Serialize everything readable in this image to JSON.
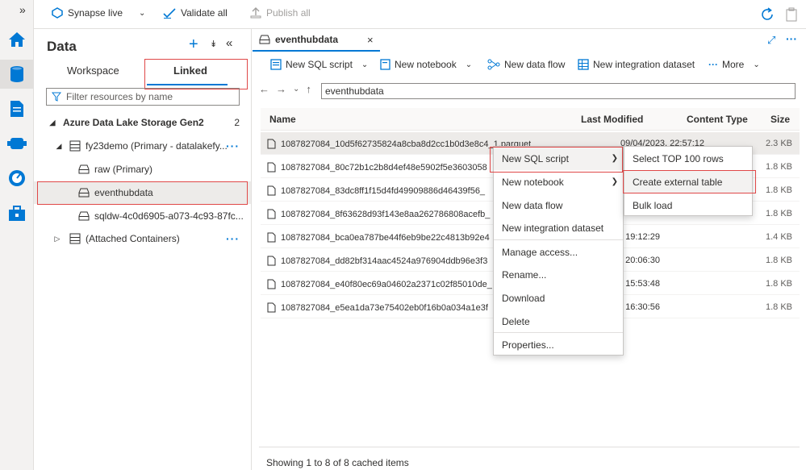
{
  "topbar": {
    "synapse_live": "Synapse live",
    "validate_all": "Validate all",
    "publish_all": "Publish all"
  },
  "data_pane": {
    "title": "Data",
    "tabs": [
      "Workspace",
      "Linked"
    ],
    "active_tab": "Linked",
    "filter_placeholder": "Filter resources by name",
    "section": "Azure Data Lake Storage Gen2",
    "section_count": "2",
    "tree": {
      "account": "fy23demo (Primary - datalakefy...",
      "containers": [
        "raw (Primary)",
        "eventhubdata",
        "sqldw-4c0d6905-a073-4c93-87fc..."
      ],
      "selected": "eventhubdata",
      "attached": "(Attached Containers)"
    }
  },
  "main": {
    "doc_tab": "eventhubdata",
    "commands": {
      "new_sql_script": "New SQL script",
      "new_notebook": "New notebook",
      "new_data_flow": "New data flow",
      "new_integration_dataset": "New integration dataset",
      "more": "More"
    },
    "path": "eventhubdata",
    "columns": [
      "Name",
      "Last Modified",
      "Content Type",
      "Size"
    ],
    "files": [
      {
        "name": "1087827084_10d5f62735824a8cba8d2cc1b0d3e8c4_1.parquet",
        "modified": "09/04/2023, 22:57:12",
        "size": "2.3 KB"
      },
      {
        "name": "1087827084_80c72b1c2b8d4ef48e5902f5e3603058",
        "modified": "",
        "size": "1.8 KB"
      },
      {
        "name": "1087827084_83dc8ff1f15d4fd49909886d46439f56_",
        "modified": "",
        "size": "1.8 KB"
      },
      {
        "name": "1087827084_8f63628d93f143e8aa262786808acefb_",
        "modified": "",
        "size": "1.8 KB"
      },
      {
        "name": "1087827084_bca0ea787be44f6eb9be22c4813b92e4",
        "modified": ", 19:12:29",
        "size": "1.4 KB"
      },
      {
        "name": "1087827084_dd82bf314aac4524a976904ddb96e3f3",
        "modified": ", 20:06:30",
        "size": "1.8 KB"
      },
      {
        "name": "1087827084_e40f80ec69a04602a2371c02f85010de_",
        "modified": ", 15:53:48",
        "size": "1.8 KB"
      },
      {
        "name": "1087827084_e5ea1da73e75402eb0f16b0a034a1e3f",
        "modified": ", 16:30:56",
        "size": "1.8 KB"
      }
    ],
    "status": "Showing 1 to 8 of 8 cached items"
  },
  "context_menu": {
    "items": [
      "New SQL script",
      "New notebook",
      "New data flow",
      "New integration dataset",
      "Manage access...",
      "Rename...",
      "Download",
      "Delete",
      "Properties..."
    ]
  },
  "submenu": {
    "items": [
      "Select TOP 100 rows",
      "Create external table",
      "Bulk load"
    ]
  },
  "colors": {
    "accent": "#0078d4",
    "highlight_box": "#e04848"
  }
}
